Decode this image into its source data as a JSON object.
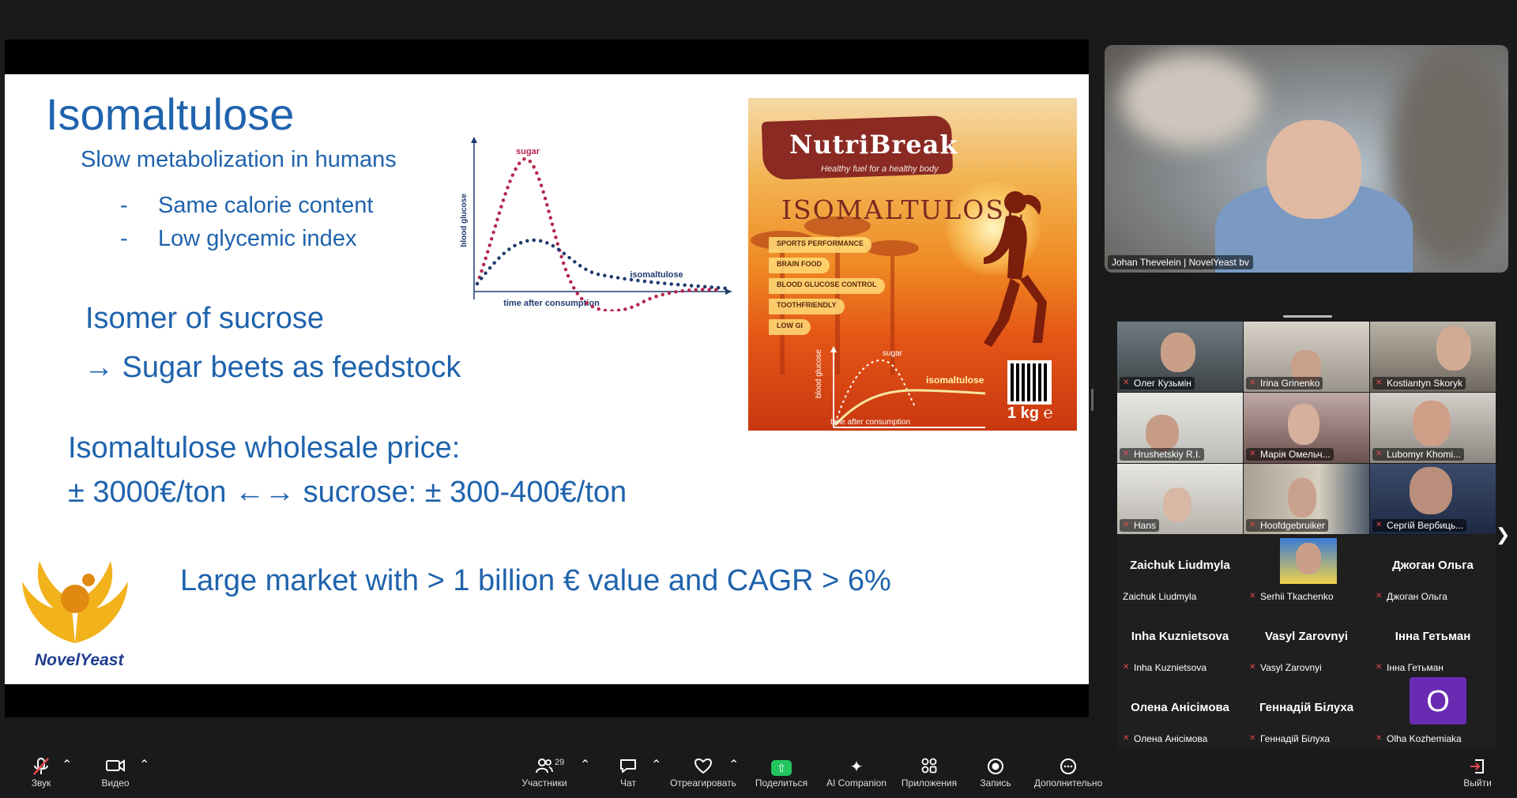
{
  "slide": {
    "title": "Isomaltulose",
    "subtitle": "Slow metabolization in humans",
    "bullets": [
      {
        "dash": "-",
        "text": "Same calorie content"
      },
      {
        "dash": "-",
        "text": "Low glycemic index"
      }
    ],
    "isomer_line": "Isomer of sucrose",
    "feedstock_line": "→ Sugar beets as feedstock",
    "price_heading": "Isomaltulose wholesale price:",
    "price_line": "± 3000€/ton ←→ sucrose: ± 300-400€/ton",
    "market_line": "Large market with > 1 billion € value and CAGR > 6%",
    "logo_text": "NovelYeast",
    "chart": {
      "ylabel": "blood glucose",
      "xlabel": "time after consumption",
      "series": [
        {
          "name": "sugar",
          "color": "#b5264d"
        },
        {
          "name": "isomaltulose",
          "color": "#1f3c6e"
        }
      ]
    },
    "product": {
      "brand": "NutriBreak",
      "tagline": "Healthy fuel for a healthy body",
      "name": "ISOMALTULOSE",
      "tags": [
        "SPORTS PERFORMANCE",
        "BRAIN FOOD",
        "BLOOD GLUCOSE CONTROL",
        "TOOTHFRIENDLY",
        "LOW GI"
      ],
      "mini_ylabel": "blood glucose",
      "mini_xlabel": "time after consumption",
      "mini_sugar": "sugar",
      "mini_iso": "isomaltulose",
      "weight": "1 kg ℮"
    }
  },
  "speaker": {
    "name": "Johan Thevelein | NovelYeast bv"
  },
  "participants": [
    {
      "name": "Олег Кузьмін",
      "video": true,
      "muted": true
    },
    {
      "name": "Irina Grinenko",
      "video": true,
      "muted": true
    },
    {
      "name": "Kostiantyn Skoryk",
      "video": true,
      "muted": true
    },
    {
      "name": "Hrushetskiy R.I.",
      "video": true,
      "muted": true
    },
    {
      "name": "Марія Омельч...",
      "video": true,
      "muted": true
    },
    {
      "name": "Lubomyr Khomi...",
      "video": true,
      "muted": true
    },
    {
      "name": "Hans",
      "video": true,
      "muted": true
    },
    {
      "name": "Hoofdgebruiker",
      "video": true,
      "muted": true
    },
    {
      "name": "Сергій Вербиць...",
      "video": true,
      "muted": true
    },
    {
      "name": "Zaichuk Liudmyla",
      "big_name": "Zaichuk Liudmyla",
      "video": false,
      "muted": false
    },
    {
      "name": "Serhii Tkachenko",
      "video": true,
      "muted": true
    },
    {
      "name": "Джоган Ольга",
      "big_name": "Джоган Ольга",
      "video": false,
      "muted": true
    },
    {
      "name": "Inha Kuznietsova",
      "big_name": "Inha Kuznietsova",
      "video": false,
      "muted": true
    },
    {
      "name": "Vasyl Zarovnyi",
      "big_name": "Vasyl Zarovnyi",
      "video": false,
      "muted": true
    },
    {
      "name": "Інна Гетьман",
      "big_name": "Інна Гетьман",
      "video": false,
      "muted": true
    },
    {
      "name": "Олена Анісімова",
      "big_name": "Олена Анісімова",
      "video": false,
      "muted": true
    },
    {
      "name": "Геннадій  Білуха",
      "big_name": "Геннадій  Білуха",
      "video": false,
      "muted": true
    },
    {
      "name": "Olha Kozhemiaka",
      "avatar_letter": "O",
      "video": false,
      "muted": true
    }
  ],
  "toolbar": {
    "audio": {
      "label": "Звук",
      "icon": "mic-muted-icon"
    },
    "video": {
      "label": "Видео",
      "icon": "camera-icon"
    },
    "participants": {
      "label": "Участники",
      "count": "29",
      "icon": "participants-icon"
    },
    "chat": {
      "label": "Чат",
      "icon": "chat-icon"
    },
    "react": {
      "label": "Отреагировать",
      "icon": "heart-icon"
    },
    "share": {
      "label": "Поделиться",
      "icon": "share-screen-icon"
    },
    "ai": {
      "label": "AI Companion",
      "icon": "sparkle-icon"
    },
    "apps": {
      "label": "Приложения",
      "icon": "apps-icon"
    },
    "record": {
      "label": "Запись",
      "icon": "record-icon"
    },
    "more": {
      "label": "Дополнительно",
      "icon": "more-icon"
    },
    "leave": {
      "label": "Выйти",
      "icon": "leave-icon"
    }
  },
  "colors": {
    "slide_text": "#1f63ad",
    "share_green": "#22c55e",
    "muted_red": "#e5484d",
    "avatar_purple": "#6a2bb3"
  }
}
